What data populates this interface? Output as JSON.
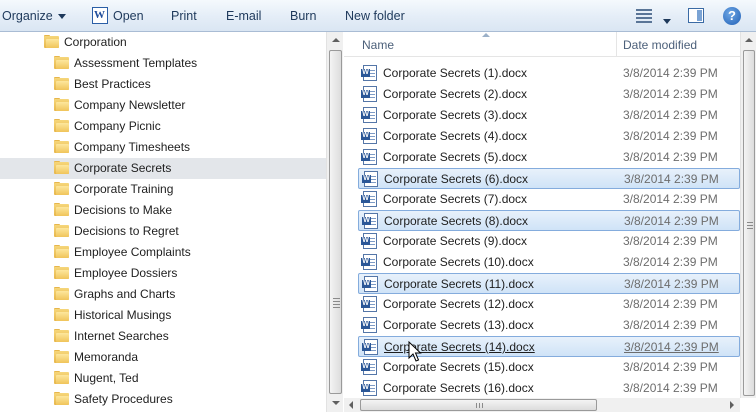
{
  "toolbar": {
    "organize_label": "Organize",
    "open_label": "Open",
    "print_label": "Print",
    "email_label": "E-mail",
    "burn_label": "Burn",
    "new_folder_label": "New folder",
    "help_label": "?"
  },
  "nav": {
    "root": "Corporation",
    "selected_index": 5,
    "folders": [
      "Assessment Templates",
      "Best Practices",
      "Company Newsletter",
      "Company Picnic",
      "Company Timesheets",
      "Corporate Secrets",
      "Corporate Training",
      "Decisions to Make",
      "Decisions to Regret",
      "Employee Complaints",
      "Employee Dossiers",
      "Graphs and Charts",
      "Historical Musings",
      "Internet Searches",
      "Memoranda",
      "Nugent, Ted",
      "Safety Procedures"
    ]
  },
  "list": {
    "columns": {
      "name": "Name",
      "date": "Date modified"
    },
    "files": [
      {
        "name": "Corporate Secrets (1).docx",
        "date": "3/8/2014 2:39 PM",
        "selected": false
      },
      {
        "name": "Corporate Secrets (2).docx",
        "date": "3/8/2014 2:39 PM",
        "selected": false
      },
      {
        "name": "Corporate Secrets (3).docx",
        "date": "3/8/2014 2:39 PM",
        "selected": false
      },
      {
        "name": "Corporate Secrets (4).docx",
        "date": "3/8/2014 2:39 PM",
        "selected": false
      },
      {
        "name": "Corporate Secrets (5).docx",
        "date": "3/8/2014 2:39 PM",
        "selected": false
      },
      {
        "name": "Corporate Secrets (6).docx",
        "date": "3/8/2014 2:39 PM",
        "selected": true
      },
      {
        "name": "Corporate Secrets (7).docx",
        "date": "3/8/2014 2:39 PM",
        "selected": false
      },
      {
        "name": "Corporate Secrets (8).docx",
        "date": "3/8/2014 2:39 PM",
        "selected": true
      },
      {
        "name": "Corporate Secrets (9).docx",
        "date": "3/8/2014 2:39 PM",
        "selected": false
      },
      {
        "name": "Corporate Secrets (10).docx",
        "date": "3/8/2014 2:39 PM",
        "selected": false
      },
      {
        "name": "Corporate Secrets (11).docx",
        "date": "3/8/2014 2:39 PM",
        "selected": true
      },
      {
        "name": "Corporate Secrets (12).docx",
        "date": "3/8/2014 2:39 PM",
        "selected": false
      },
      {
        "name": "Corporate Secrets (13).docx",
        "date": "3/8/2014 2:39 PM",
        "selected": false
      },
      {
        "name": "Corporate Secrets (14).docx",
        "date": "3/8/2014 2:39 PM",
        "selected": true,
        "hovered": true
      },
      {
        "name": "Corporate Secrets (15).docx",
        "date": "3/8/2014 2:39 PM",
        "selected": false
      },
      {
        "name": "Corporate Secrets (16).docx",
        "date": "3/8/2014 2:39 PM",
        "selected": false
      }
    ]
  }
}
